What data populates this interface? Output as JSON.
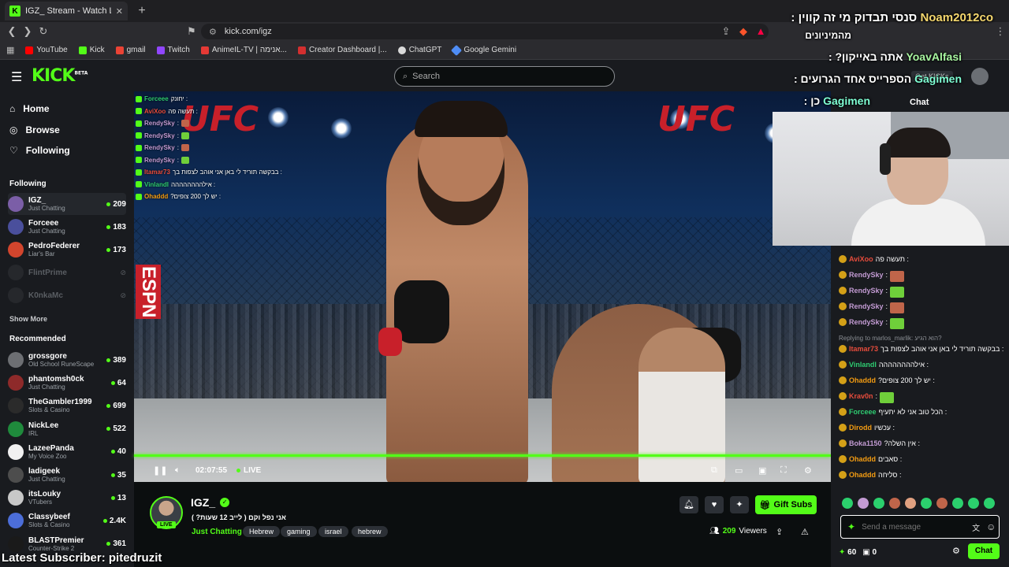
{
  "browser": {
    "tab_title": "IGZ_ Stream - Watch Live on",
    "url": "kick.com/igz",
    "bookmarks": [
      {
        "label": "YouTube",
        "color": "#ff0000"
      },
      {
        "label": "Kick",
        "color": "#53fc18"
      },
      {
        "label": "gmail",
        "color": "#ea4335"
      },
      {
        "label": "Twitch",
        "color": "#9146ff"
      },
      {
        "label": "AnimeIL-TV | אנימה...",
        "color": "#e53935"
      },
      {
        "label": "Creator Dashboard |...",
        "color": "#d32f2f"
      },
      {
        "label": "ChatGPT",
        "color": "#d9d9d9"
      },
      {
        "label": "Google Gemini",
        "color": "#4f8df5"
      }
    ]
  },
  "header": {
    "logo": "KICK",
    "logo_badge": "BETA",
    "search_placeholder": "Search",
    "get_kicks": "Get KICKs",
    "chat_label": "Chat"
  },
  "sidebar": {
    "nav": [
      {
        "label": "Home",
        "icon": "home-icon"
      },
      {
        "label": "Browse",
        "icon": "compass-icon"
      },
      {
        "label": "Following",
        "icon": "heart-icon"
      }
    ],
    "following_heading": "Following",
    "following": [
      {
        "name": "IGZ_",
        "category": "Just Chatting",
        "count": "209",
        "color": "#7b5ea7",
        "selected": true
      },
      {
        "name": "Forceee",
        "category": "Just Chatting",
        "count": "183",
        "color": "#4a4f9c"
      },
      {
        "name": "PedroFederer",
        "category": "Liar's Bar",
        "count": "173",
        "color": "#d2452d"
      },
      {
        "name": "FlintPrime",
        "category": "",
        "count": "",
        "color": "#3a3d42",
        "offline": true
      },
      {
        "name": "K0nkaMc",
        "category": "",
        "count": "",
        "color": "#3a3d42",
        "offline": true
      }
    ],
    "show_more": "Show More",
    "recommended_heading": "Recommended",
    "recommended": [
      {
        "name": "grossgore",
        "category": "Old School RuneScape",
        "count": "389",
        "color": "#6d6f73"
      },
      {
        "name": "phantomsh0ck",
        "category": "Just Chatting",
        "count": "64",
        "color": "#8e2a2a"
      },
      {
        "name": "TheGambler1999",
        "category": "Slots & Casino",
        "count": "699",
        "color": "#2b2b2b"
      },
      {
        "name": "NickLee",
        "category": "IRL",
        "count": "522",
        "color": "#1f8a3c"
      },
      {
        "name": "LazeePanda",
        "category": "My Voice Zoo",
        "count": "40",
        "color": "#f1f1f1"
      },
      {
        "name": "ladigeek",
        "category": "Just Chatting",
        "count": "35",
        "color": "#4d4d4d"
      },
      {
        "name": "itsLouky",
        "category": "VTubers",
        "count": "13",
        "color": "#c8c8c8"
      },
      {
        "name": "Classybeef",
        "category": "Slots & Casino",
        "count": "2.4K",
        "color": "#4c6ed9"
      },
      {
        "name": "BLASTPremier",
        "category": "Counter-Strike 2",
        "count": "361",
        "color": "#1a1a1a"
      }
    ]
  },
  "overlay_chat": [
    {
      "name": "Forceee",
      "msg": ": יחונק",
      "color": "#2ecc71"
    },
    {
      "name": "AviXoo",
      "msg": ": תעשה פה",
      "color": "#e74c3c"
    },
    {
      "name": "RendySky",
      "msg": ":",
      "color": "#c39bd3",
      "emote": "#c0654a"
    },
    {
      "name": "RendySky",
      "msg": ":",
      "color": "#c39bd3",
      "emote": "#6fcf3a"
    },
    {
      "name": "RendySky",
      "msg": ":",
      "color": "#c39bd3",
      "emote": "#c0654a"
    },
    {
      "name": "RendySky",
      "msg": ":",
      "color": "#c39bd3",
      "emote": "#6fcf3a"
    },
    {
      "name": "Itamar73",
      "msg": ": בבקשה תוריד לי באן אני אוהב לצפות בך",
      "color": "#e74c3c"
    },
    {
      "name": "Vinlandl",
      "msg": ": אילהההההההה",
      "color": "#2ecc71"
    },
    {
      "name": "Ohaddd",
      "msg": ": יש לך 200 צופים?",
      "color": "#f39c12"
    }
  ],
  "player": {
    "time": "02:07:55",
    "live_label": "LIVE"
  },
  "stream": {
    "channel": "IGZ_",
    "live_badge": "LIVE",
    "title": "אני נפל וקם ( לייב 12 שעות? )",
    "category": "Just Chatting",
    "tags": [
      "Hebrew",
      "gaming",
      "israel",
      "hebrew"
    ],
    "gift_subs": "Gift Subs",
    "viewers_count": "209",
    "viewers_label": "Viewers"
  },
  "alerts": [
    {
      "user": "Noam2012co",
      "text": "סנסי תבדוק מי זה קווין :",
      "line2": "מהמיניונים"
    },
    {
      "user": "YoavAlfasi",
      "text": "אתה באייקון? :"
    },
    {
      "user": "Gagimen",
      "text": "הספרייס אחד הגרועים :"
    },
    {
      "user": "Gagimen",
      "text": "כן :"
    }
  ],
  "chat": [
    {
      "name": "AviXoo",
      "msg": ": תעשה פה",
      "color": "#e74c3c"
    },
    {
      "name": "RendySky",
      "msg": ":",
      "color": "#c39bd3",
      "emote": "#c0654a"
    },
    {
      "name": "RendySky",
      "msg": ":",
      "color": "#c39bd3",
      "emote": "#6fcf3a"
    },
    {
      "name": "RendySky",
      "msg": ":",
      "color": "#c39bd3",
      "emote": "#c0654a"
    },
    {
      "name": "RendySky",
      "msg": ":",
      "color": "#c39bd3",
      "emote": "#6fcf3a"
    },
    {
      "reply": "Replying to marlos_marlik: הוא הגיע?"
    },
    {
      "name": "Itamar73",
      "msg": ": בבקשה תוריד לי באן אני אוהב לצפות בך",
      "color": "#e74c3c"
    },
    {
      "name": "Vinlandl",
      "msg": ": אילהההההההה",
      "color": "#2ecc71"
    },
    {
      "name": "Ohaddd",
      "msg": ": יש לך 200 צופים?",
      "color": "#f39c12"
    },
    {
      "name": "Krav0n",
      "msg": ":",
      "color": "#e74c3c",
      "emote": "#6fcf3a"
    },
    {
      "name": "Forceee",
      "msg": ": הכל טוב אני לא יתעיף",
      "color": "#2ecc71"
    },
    {
      "name": "Dirodd",
      "msg": ": עכשיו",
      "color": "#f39c12"
    },
    {
      "name": "Boka1150",
      "msg": ": אין השלה?",
      "color": "#c39bd3"
    },
    {
      "name": "Ohaddd",
      "msg": ": סאבים",
      "color": "#f39c12"
    },
    {
      "name": "Ohaddd",
      "msg": ": סליחה",
      "color": "#f39c12"
    }
  ],
  "chat_input": {
    "placeholder": "Send a message",
    "kicks": "60",
    "points": "0",
    "send_label": "Chat"
  },
  "overlay": {
    "latest_subscriber": "Latest Subscriber: pitedruzit"
  }
}
